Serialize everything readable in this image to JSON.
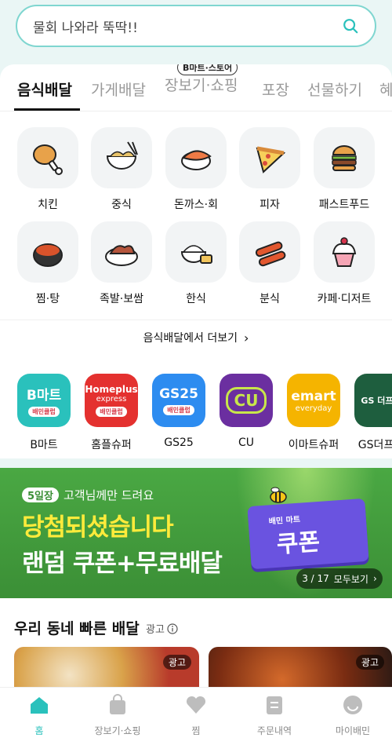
{
  "search": {
    "text": "물회 나와라 뚝딱!!"
  },
  "tabs": [
    {
      "label": "음식배달"
    },
    {
      "label": "가게배달"
    },
    {
      "label": "장보기·쇼핑",
      "badge": "B마트·스토어"
    },
    {
      "label": "포장"
    },
    {
      "label": "선물하기"
    },
    {
      "label": "혜"
    }
  ],
  "categories": [
    {
      "label": "치킨",
      "icon": "chicken-icon"
    },
    {
      "label": "중식",
      "icon": "noodle-bowl-icon"
    },
    {
      "label": "돈까스·회",
      "icon": "sushi-icon"
    },
    {
      "label": "피자",
      "icon": "pizza-icon"
    },
    {
      "label": "패스트푸드",
      "icon": "burger-icon"
    },
    {
      "label": "찜·탕",
      "icon": "stew-pot-icon"
    },
    {
      "label": "족발·보쌈",
      "icon": "pork-platter-icon"
    },
    {
      "label": "한식",
      "icon": "rice-bowl-icon"
    },
    {
      "label": "분식",
      "icon": "tteokbokki-icon"
    },
    {
      "label": "카페·디저트",
      "icon": "cupcake-icon"
    }
  ],
  "more_link": "음식배달에서 더보기",
  "stores": [
    {
      "label": "B마트",
      "tile": "B마트",
      "club": "배민클럽",
      "color": "#2ac1bc"
    },
    {
      "label": "홈플슈퍼",
      "tile": "Homeplus",
      "tile2": "express",
      "club": "배민클럽",
      "color": "#e4312f"
    },
    {
      "label": "GS25",
      "tile": "GS25",
      "club": "배민클럽",
      "color": "#2d8cf0"
    },
    {
      "label": "CU",
      "tile": "CU",
      "color": "#6b2fa0"
    },
    {
      "label": "이마트슈퍼",
      "tile": "emart",
      "tile2": "everyday",
      "color": "#f5b400"
    },
    {
      "label": "GS더프레",
      "tile": "GS 더프레",
      "color": "#1e5e3e"
    }
  ],
  "banner": {
    "pill": "5일장",
    "top": "고객님께만 드려요",
    "line1": "당첨되셨습니다",
    "line2": "랜덤 쿠폰+무료배달",
    "ticket_small": "배민 마트",
    "ticket_big": "쿠폰",
    "pager": "3 / 17",
    "pager_more": "모두보기"
  },
  "section": {
    "title": "우리 동네 빠른 배달",
    "ad": "광고",
    "card_badge": "광고"
  },
  "nav": [
    {
      "label": "홈",
      "icon": "home-icon"
    },
    {
      "label": "장보기·쇼핑",
      "icon": "shopping-bag-icon"
    },
    {
      "label": "찜",
      "icon": "heart-icon"
    },
    {
      "label": "주문내역",
      "icon": "order-list-icon"
    },
    {
      "label": "마이배민",
      "icon": "profile-icon"
    }
  ],
  "colors": {
    "accent": "#2ac1bc",
    "banner_green": "#4aa843",
    "headline_yellow": "#ffeb3b"
  }
}
